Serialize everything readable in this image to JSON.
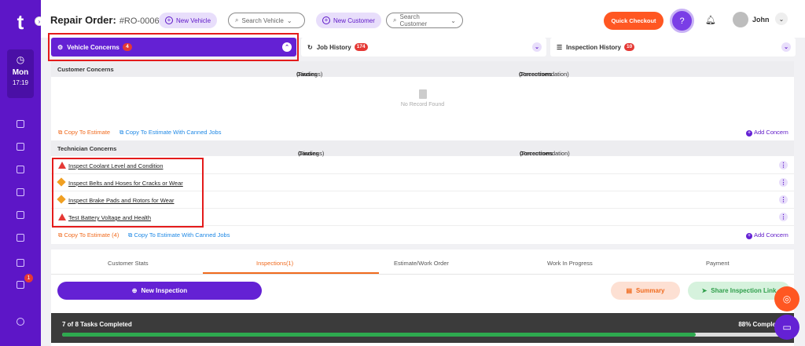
{
  "sidebar": {
    "logo": "t",
    "day": "Mon",
    "time": "17:19",
    "notification_count": "1"
  },
  "header": {
    "title": "Repair Order:",
    "ro_number": "#RO-000668",
    "new_vehicle": "New Vehicle",
    "search_vehicle": "Search Vehicle",
    "new_customer": "New Customer",
    "search_customer": "Search Customer",
    "quick_checkout": "Quick Checkout",
    "user_name": "John"
  },
  "tabs": [
    {
      "label": "Vehicle Concerns",
      "count": "4"
    },
    {
      "label": "Job History",
      "count": "174"
    },
    {
      "label": "Inspection History",
      "count": "10"
    }
  ],
  "customer_concerns": {
    "headers": {
      "concerns": "Customer Concerns",
      "causes": "Causes",
      "causes_note": "(Findings)",
      "corrections": "Corrections",
      "corrections_note": "(Recommendation)"
    },
    "empty": "No Record Found",
    "copy_to_estimate": "Copy To Estimate",
    "copy_canned": "Copy To Estimate With Canned Jobs",
    "add_concern": "Add Concern"
  },
  "technician_concerns": {
    "headers": {
      "concerns": "Technician Concerns",
      "causes": "Causes",
      "causes_note": "(Findings)",
      "corrections": "Corrections",
      "corrections_note": "(Recommendation)"
    },
    "rows": [
      {
        "text": "Inspect Coolant Level and Condition",
        "severity": "red"
      },
      {
        "text": "Inspect Belts and Hoses for Cracks or Wear",
        "severity": "orange"
      },
      {
        "text": "Inspect Brake Pads and Rotors for Wear",
        "severity": "orange"
      },
      {
        "text": "Test Battery Voltage and Health",
        "severity": "red"
      }
    ],
    "copy_to_estimate": "Copy To Estimate (4)",
    "copy_canned": "Copy To Estimate With Canned Jobs",
    "add_concern": "Add Concern"
  },
  "bottom_tabs": [
    "Customer Stats",
    "Inspections(1)",
    "Estimate/Work Order",
    "Work In Progress",
    "Payment"
  ],
  "actions": {
    "new_inspection": "New Inspection",
    "summary": "Summary",
    "share_link": "Share Inspection Link"
  },
  "progress": {
    "label": "7 of 8 Tasks Completed",
    "percent_text": "88% Complete",
    "fraction": 0.88
  },
  "colors": {
    "brand": "#5d16c7",
    "accent": "#ff5722",
    "danger": "#e53935",
    "success": "#2ea94f"
  }
}
